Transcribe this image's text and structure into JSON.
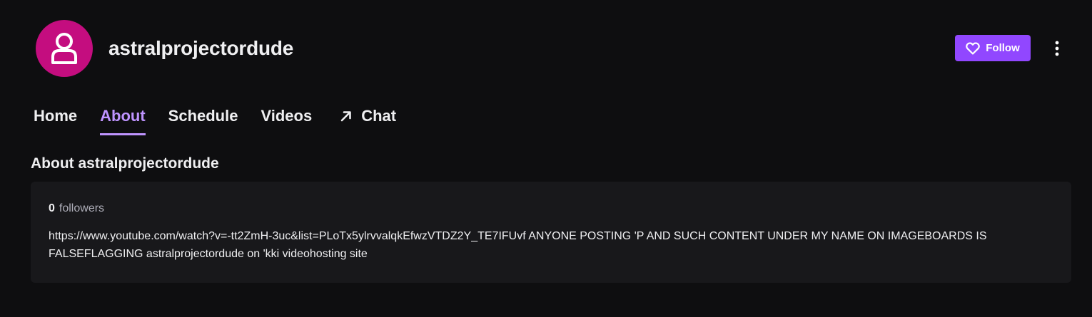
{
  "channel": {
    "name": "astralprojectordude",
    "avatar_color": "#c40d7f"
  },
  "actions": {
    "follow_label": "Follow",
    "follow_icon": "heart-icon",
    "more_icon": "vertical-ellipsis-icon"
  },
  "nav": {
    "items": [
      {
        "label": "Home",
        "active": false
      },
      {
        "label": "About",
        "active": true
      },
      {
        "label": "Schedule",
        "active": false
      },
      {
        "label": "Videos",
        "active": false
      },
      {
        "label": "Chat",
        "active": false,
        "icon": "external-arrow-icon"
      }
    ]
  },
  "about": {
    "title": "About astralprojectordude",
    "followers_count": "0",
    "followers_label": "followers",
    "description": "https://www.youtube.com/watch?v=-tt2ZmH-3uc&list=PLoTx5ylrvvalqkEfwzVTDZ2Y_TE7IFUvf ANYONE POSTING 'P AND SUCH CONTENT UNDER MY NAME ON IMAGEBOARDS IS FALSEFLAGGING astralprojectordude on 'kki videohosting site"
  },
  "colors": {
    "background": "#0e0e10",
    "accent": "#9147ff",
    "active_tab": "#bf94ff",
    "card": "#18181b"
  }
}
